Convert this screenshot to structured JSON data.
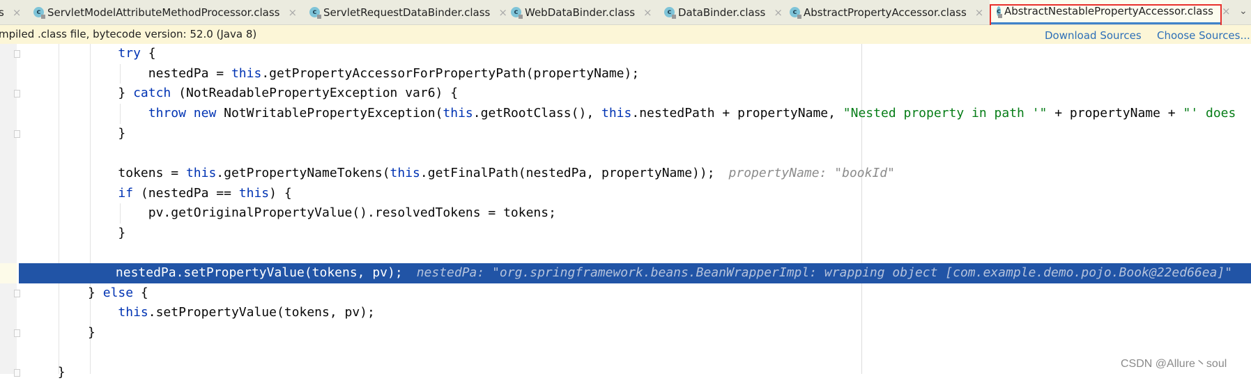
{
  "tabs": [
    {
      "label": "s",
      "active": false,
      "icon": "class-icon"
    },
    {
      "label": "ServletModelAttributeMethodProcessor.class",
      "active": false,
      "icon": "class-icon"
    },
    {
      "label": "ServletRequestDataBinder.class",
      "active": false,
      "icon": "class-icon"
    },
    {
      "label": "WebDataBinder.class",
      "active": false,
      "icon": "class-icon"
    },
    {
      "label": "DataBinder.class",
      "active": false,
      "icon": "class-icon"
    },
    {
      "label": "AbstractPropertyAccessor.class",
      "active": false,
      "icon": "class-icon"
    },
    {
      "label": "AbstractNestablePropertyAccessor.class",
      "active": true,
      "icon": "class-icon"
    }
  ],
  "tab_icon_letter": "c",
  "close_glyph": "×",
  "more_tabs_glyph": "⌄",
  "banner": {
    "message": "mpiled .class file, bytecode version: 52.0 (Java 8)",
    "download_sources": "Download Sources",
    "choose_sources": "Choose Sources..."
  },
  "colors": {
    "keyword": "#0033b3",
    "string": "#067d17",
    "highlight": "#2154a6",
    "active_tab_outline": "#e8302c"
  },
  "code": {
    "highlighted_line": 12,
    "lines": [
      {
        "indent": 4,
        "tokens": [
          [
            "kw",
            "try"
          ],
          [
            "",
            "{"
          ]
        ],
        "sep": [
          " "
        ]
      },
      {
        "indent": 5,
        "tokens": [
          [
            "",
            "nestedPa = "
          ],
          [
            "kw",
            "this"
          ],
          [
            "",
            ".getPropertyAccessorForPropertyPath(propertyName);"
          ]
        ]
      },
      {
        "indent": 4,
        "tokens": [
          [
            "",
            "} "
          ],
          [
            "kw",
            "catch"
          ],
          [
            "",
            " (NotReadablePropertyException var6) {"
          ]
        ]
      },
      {
        "indent": 5,
        "tokens": [
          [
            "kw",
            "throw"
          ],
          [
            "",
            " "
          ],
          [
            "kw",
            "new"
          ],
          [
            "",
            " NotWritablePropertyException("
          ],
          [
            "kw",
            "this"
          ],
          [
            "",
            ".getRootClass(), "
          ],
          [
            "kw",
            "this"
          ],
          [
            "",
            ".nestedPath + propertyName, "
          ],
          [
            "str",
            "\"Nested property in path '\""
          ],
          [
            "",
            " + propertyName + "
          ],
          [
            "str",
            "\"' does"
          ]
        ]
      },
      {
        "indent": 4,
        "tokens": [
          [
            "",
            "}"
          ]
        ]
      },
      {
        "indent": 0,
        "tokens": []
      },
      {
        "indent": 4,
        "tokens": [
          [
            "",
            "tokens = "
          ],
          [
            "kw",
            "this"
          ],
          [
            "",
            ".getPropertyNameTokens("
          ],
          [
            "kw",
            "this"
          ],
          [
            "",
            ".getFinalPath(nestedPa, propertyName));"
          ]
        ],
        "hint": "propertyName: \"bookId\""
      },
      {
        "indent": 4,
        "tokens": [
          [
            "kw",
            "if"
          ],
          [
            "",
            " (nestedPa == "
          ],
          [
            "kw",
            "this"
          ],
          [
            "",
            ") {"
          ]
        ]
      },
      {
        "indent": 5,
        "tokens": [
          [
            "",
            "pv.getOriginalPropertyValue().resolvedTokens = tokens;"
          ]
        ]
      },
      {
        "indent": 4,
        "tokens": [
          [
            "",
            "}"
          ]
        ]
      },
      {
        "indent": 0,
        "tokens": []
      },
      {
        "indent": 4,
        "tokens": [
          [
            "",
            "nestedPa.setPropertyValue(tokens, pv);"
          ]
        ],
        "hint": "nestedPa: \"org.springframework.beans.BeanWrapperImpl: wrapping object [com.example.demo.pojo.Book@22ed66ea]\""
      },
      {
        "indent": 3,
        "tokens": [
          [
            "",
            "} "
          ],
          [
            "kw",
            "else"
          ],
          [
            "",
            " {"
          ]
        ]
      },
      {
        "indent": 4,
        "tokens": [
          [
            "kw",
            "this"
          ],
          [
            "",
            ".setPropertyValue(tokens, pv);"
          ]
        ]
      },
      {
        "indent": 3,
        "tokens": [
          [
            "",
            "}"
          ]
        ]
      },
      {
        "indent": 0,
        "tokens": []
      },
      {
        "indent": 2,
        "tokens": [
          [
            "",
            "}"
          ]
        ]
      }
    ]
  },
  "watermark": "CSDN @Allure丶soul"
}
